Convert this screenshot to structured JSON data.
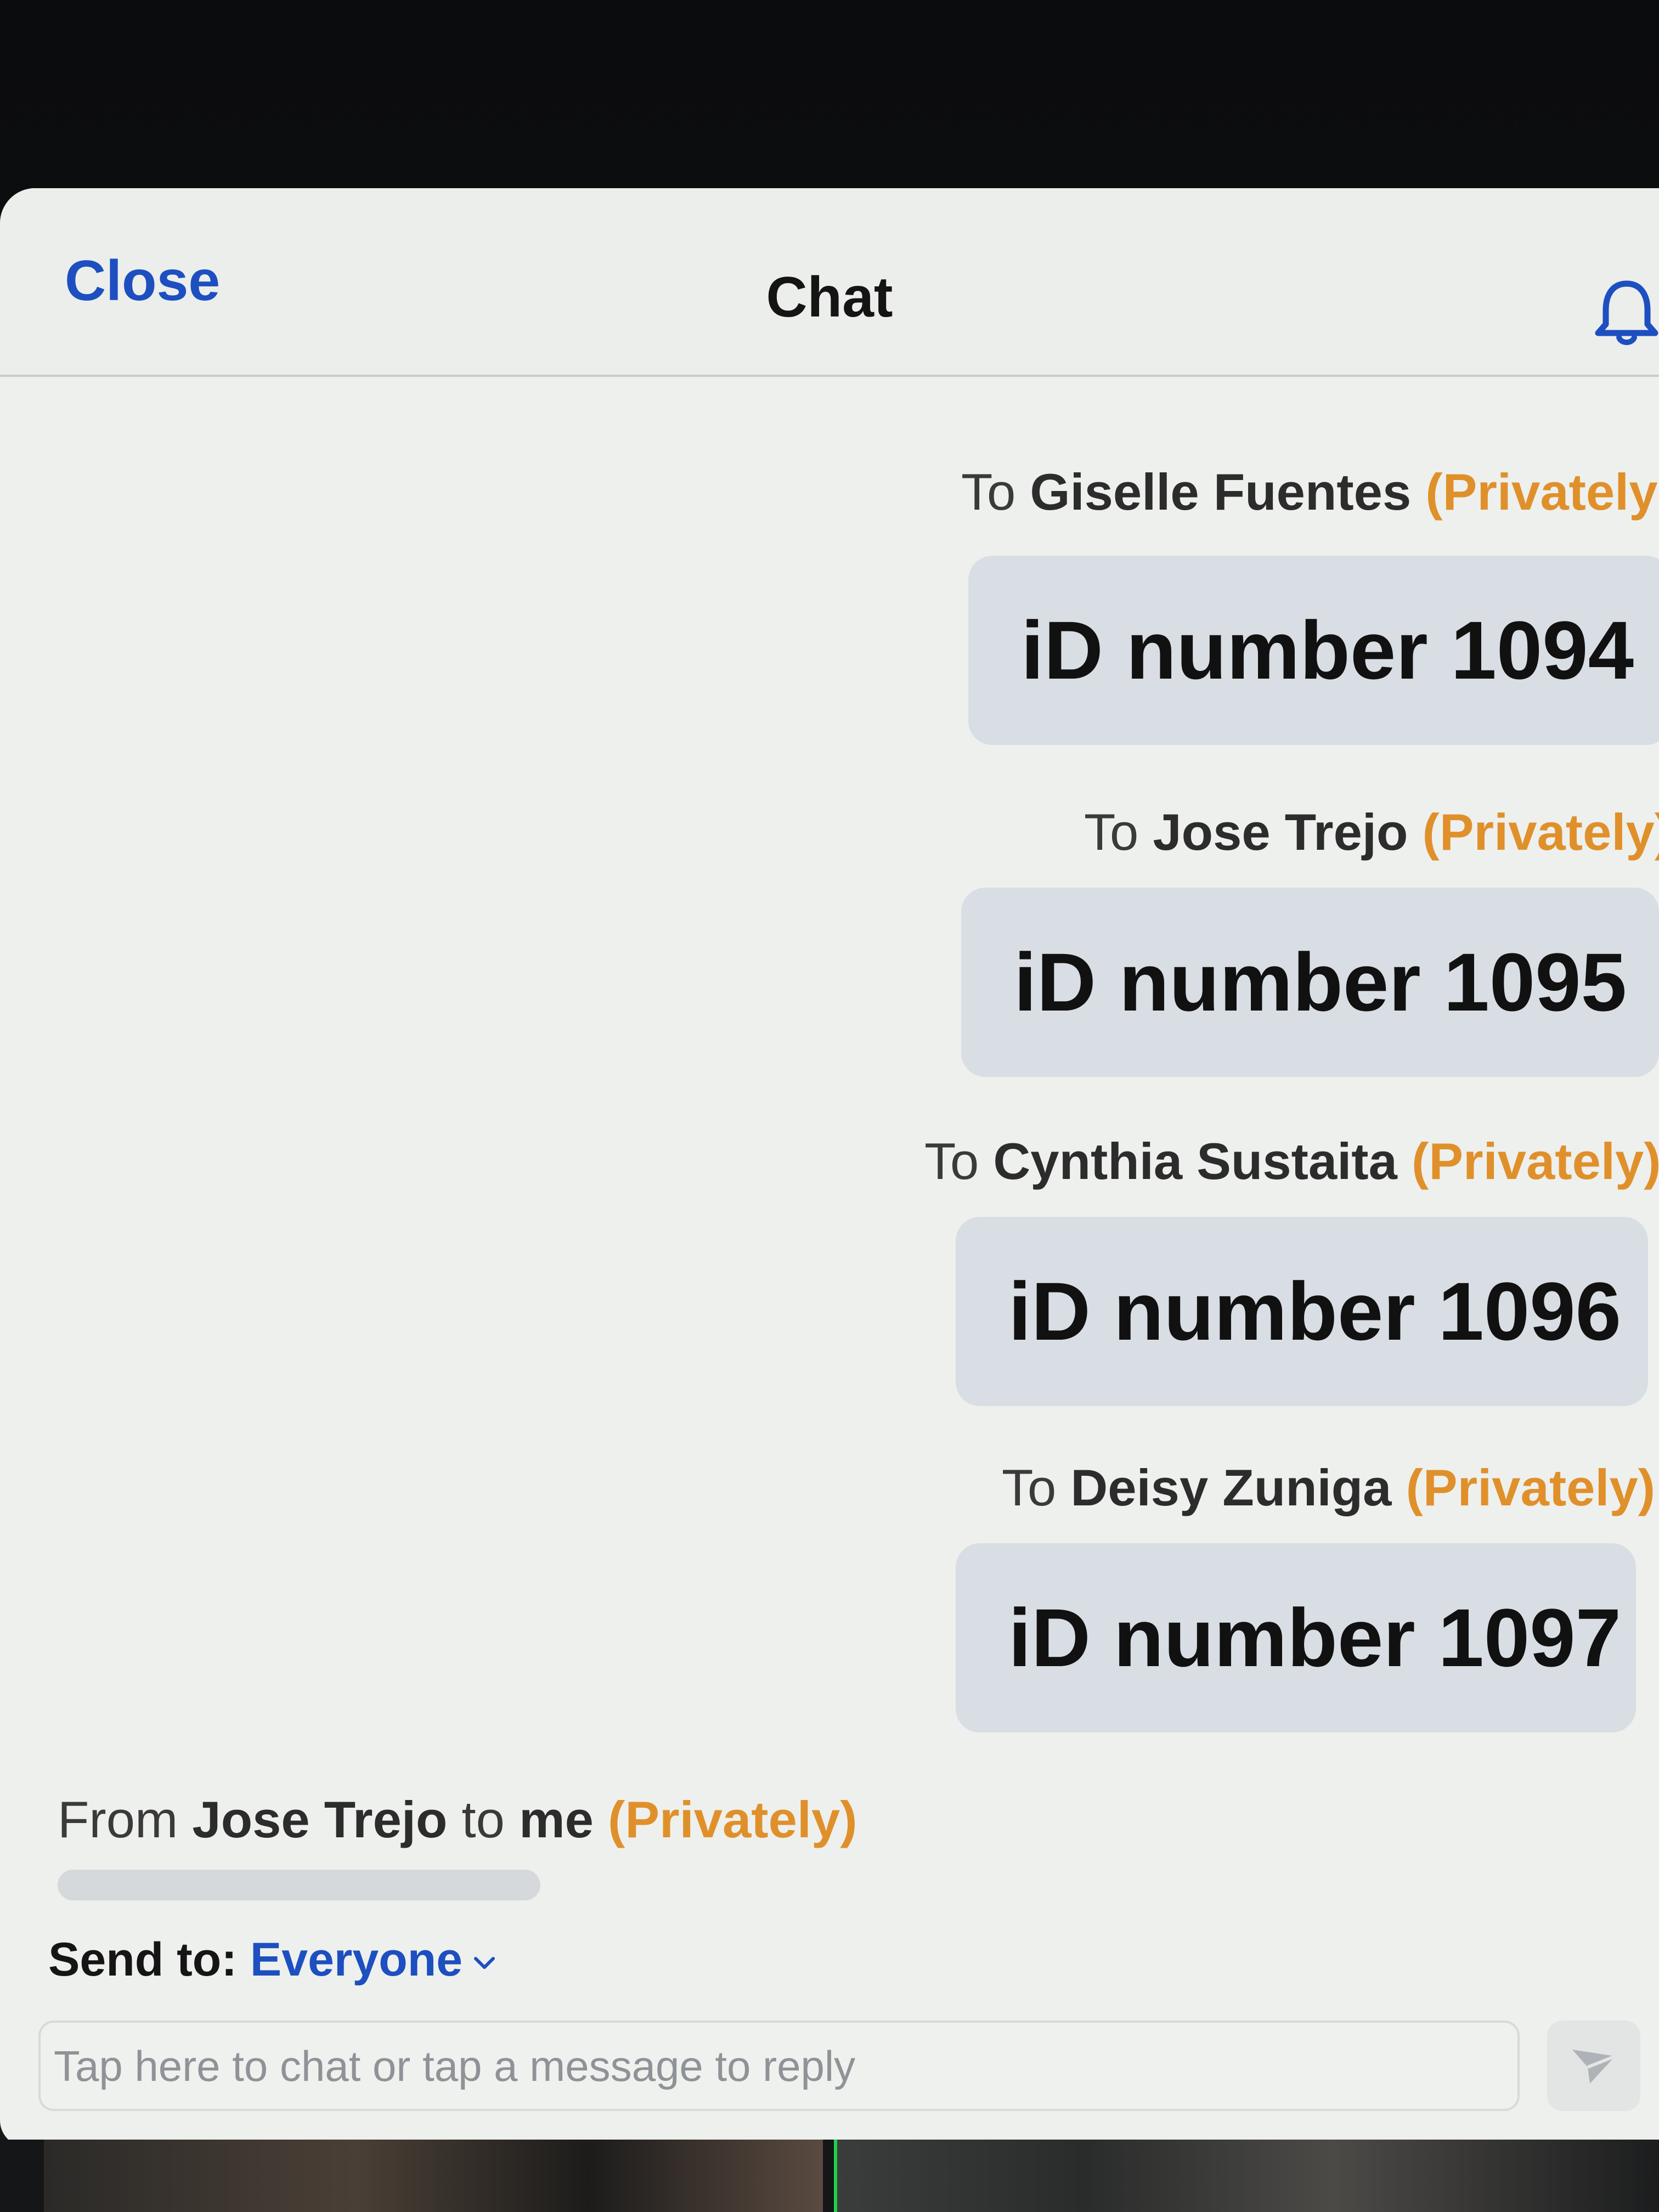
{
  "header": {
    "close_label": "Close",
    "title": "Chat",
    "bell_icon": "bell-icon"
  },
  "messages": [
    {
      "prefix": "To ",
      "name": "Giselle Fuentes",
      "privacy": "(Privately",
      "text": "iD number 1094"
    },
    {
      "prefix": "To ",
      "name": "Jose Trejo",
      "privacy": "(Privately)",
      "text": "iD number 1095"
    },
    {
      "prefix": "To ",
      "name": "Cynthia Sustaita",
      "privacy": "(Privately)",
      "text": "iD number 1096"
    },
    {
      "prefix": "To ",
      "name": "Deisy Zuniga",
      "privacy": "(Privately)",
      "text": "iD number 1097"
    }
  ],
  "incoming": {
    "prefix": "From ",
    "name": "Jose Trejo",
    "middle": " to ",
    "recipient": "me",
    "privacy": "(Privately)"
  },
  "composer": {
    "send_to_label": "Send to:",
    "send_to_value": "Everyone",
    "placeholder": "Tap here to chat or tap a message to reply",
    "send_icon": "send-icon",
    "dropdown_icon": "chevron-down-icon"
  },
  "colors": {
    "accent_blue": "#1d4fc0",
    "private_orange": "#e0902b",
    "bubble_bg": "#d8dee3",
    "panel_bg": "#eef0ed"
  }
}
